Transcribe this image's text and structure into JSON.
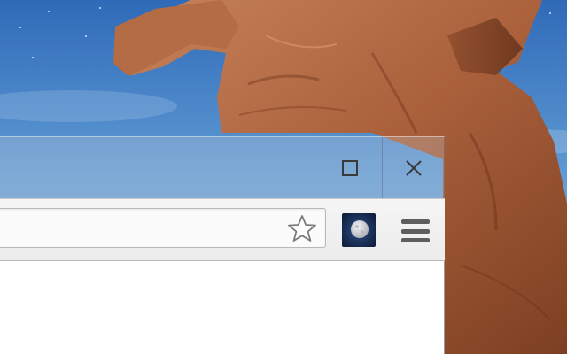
{
  "window": {
    "controls": {
      "maximize_icon": "maximize-icon",
      "close_icon": "close-icon",
      "close_glyph": "✕"
    }
  },
  "toolbar": {
    "omnibox": {
      "value": "",
      "placeholder": ""
    },
    "bookmark_icon": "star-icon",
    "extension_icon": "moon-icon",
    "menu_icon": "hamburger-menu-icon"
  },
  "colors": {
    "sky_top": "#3f78c0",
    "rock": "#b5714a",
    "toolbar_bg": "#efefef",
    "page_bg": "#ffffff"
  }
}
